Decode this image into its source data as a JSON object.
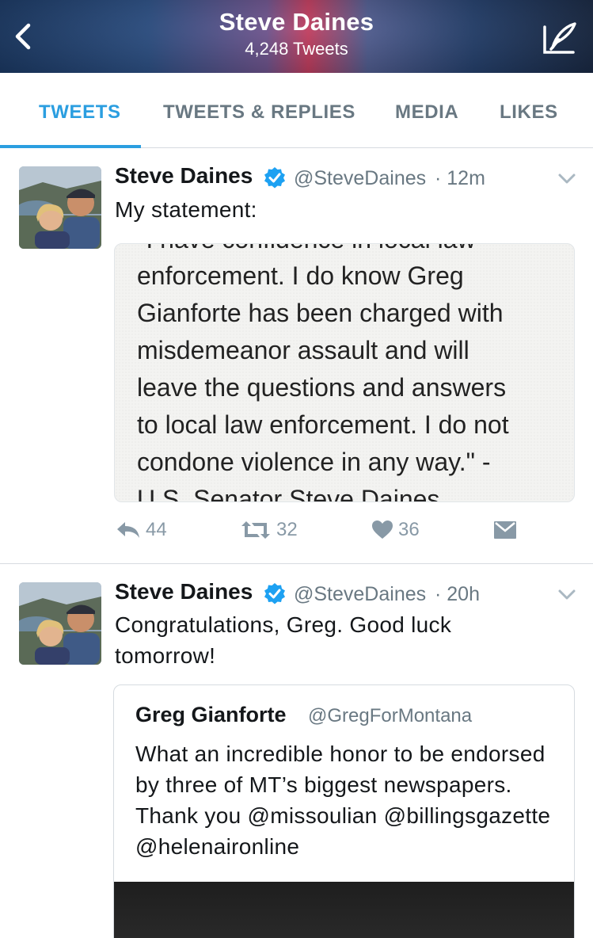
{
  "header": {
    "title": "Steve Daines",
    "subtitle": "4,248 Tweets"
  },
  "tabs": [
    {
      "label": "TWEETS",
      "active": true
    },
    {
      "label": "TWEETS & REPLIES",
      "active": false
    },
    {
      "label": "MEDIA",
      "active": false
    },
    {
      "label": "LIKES",
      "active": false
    }
  ],
  "colors": {
    "accent": "#2b9ee0",
    "verified": "#1da1f2",
    "muted": "#8899a6"
  },
  "tweets": [
    {
      "name": "Steve Daines",
      "handle": "@SteveDaines",
      "time": "· 12m",
      "text": "My statement:",
      "image_lines": [
        "\"I have confidence in local law",
        "enforcement. I do know Greg",
        "Gianforte has been charged with",
        "misdemeanor assault and will",
        "leave the questions and answers",
        "to local law enforcement. I do not",
        "condone violence in any way.\" -",
        "U.S. Senator Steve Daines"
      ],
      "replies": "44",
      "retweets": "32",
      "likes": "36"
    },
    {
      "name": "Steve Daines",
      "handle": "@SteveDaines",
      "time": "· 20h",
      "text_line1": "Congratulations, Greg.  Good luck",
      "text_line2": "tomorrow!",
      "quote": {
        "name": "Greg Gianforte",
        "handle": "@GregForMontana",
        "text": "What an incredible honor to be endorsed by three of MT’s biggest newspapers. Thank you @missoulian @billingsgazette @helenaironline"
      }
    }
  ]
}
